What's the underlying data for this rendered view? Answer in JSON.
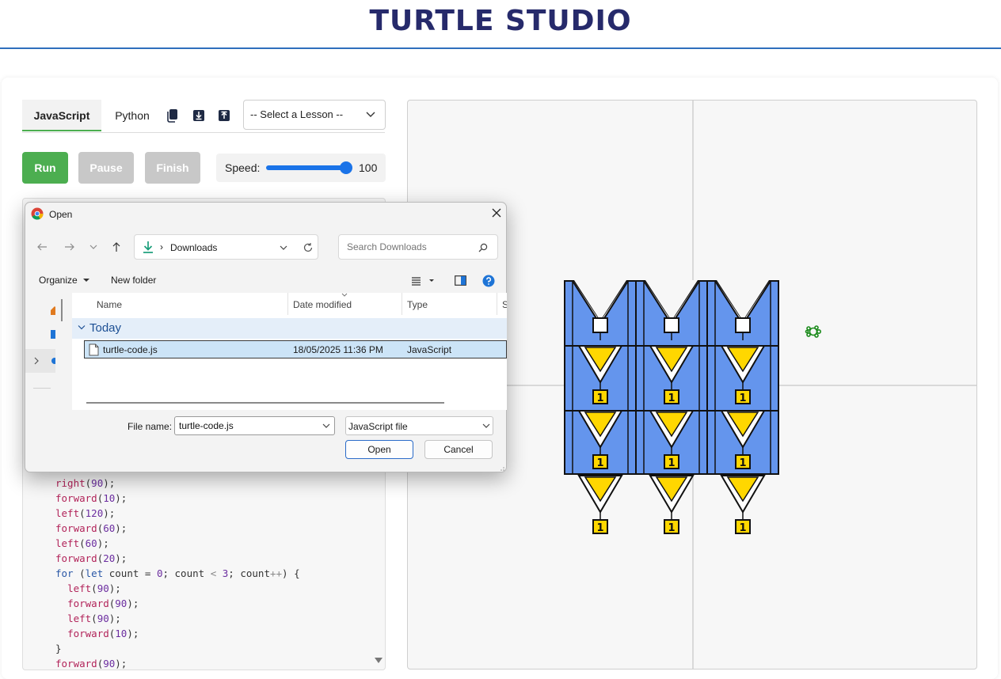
{
  "app": {
    "title": "TURTLE STUDIO"
  },
  "tabs": [
    {
      "label": "JavaScript",
      "active": true
    },
    {
      "label": "Python",
      "active": false
    }
  ],
  "toolbar_icons": [
    "copy-icon",
    "download-icon",
    "upload-icon"
  ],
  "lesson_select": {
    "value": "-- Select a Lesson --"
  },
  "controls": {
    "run_label": "Run",
    "pause_label": "Pause",
    "finish_label": "Finish",
    "speed_label": "Speed:",
    "speed_value": "100",
    "speed_level": 100
  },
  "code_lines": [
    "right(90);",
    "forward(10);",
    "left(120);",
    "forward(60);",
    "left(60);",
    "forward(20);",
    "for (let count = 0; count < 3; count++) {",
    "  left(90);",
    "  forward(90);",
    "  left(90);",
    "  forward(10);",
    "}",
    "forward(90);"
  ],
  "canvas": {
    "badge_label": "1",
    "colors": {
      "shape_fill": "#6495ED",
      "triangle_fill": "#FFD700",
      "stroke": "#111111",
      "turtle": "#1a8a1a",
      "axis": "#cfcfcf"
    }
  },
  "dialog": {
    "title": "Open",
    "location": "Downloads",
    "search_placeholder": "Search Downloads",
    "organize_label": "Organize",
    "new_folder_label": "New folder",
    "columns": [
      "Name",
      "Date modified",
      "Type",
      "S"
    ],
    "group_label": "Today",
    "files": [
      {
        "name": "turtle-code.js",
        "date": "18/05/2025 11:36 PM",
        "type": "JavaScript"
      }
    ],
    "file_name_label": "File name:",
    "file_name_value": "turtle-code.js",
    "file_type_value": "JavaScript file",
    "open_label": "Open",
    "cancel_label": "Cancel"
  }
}
